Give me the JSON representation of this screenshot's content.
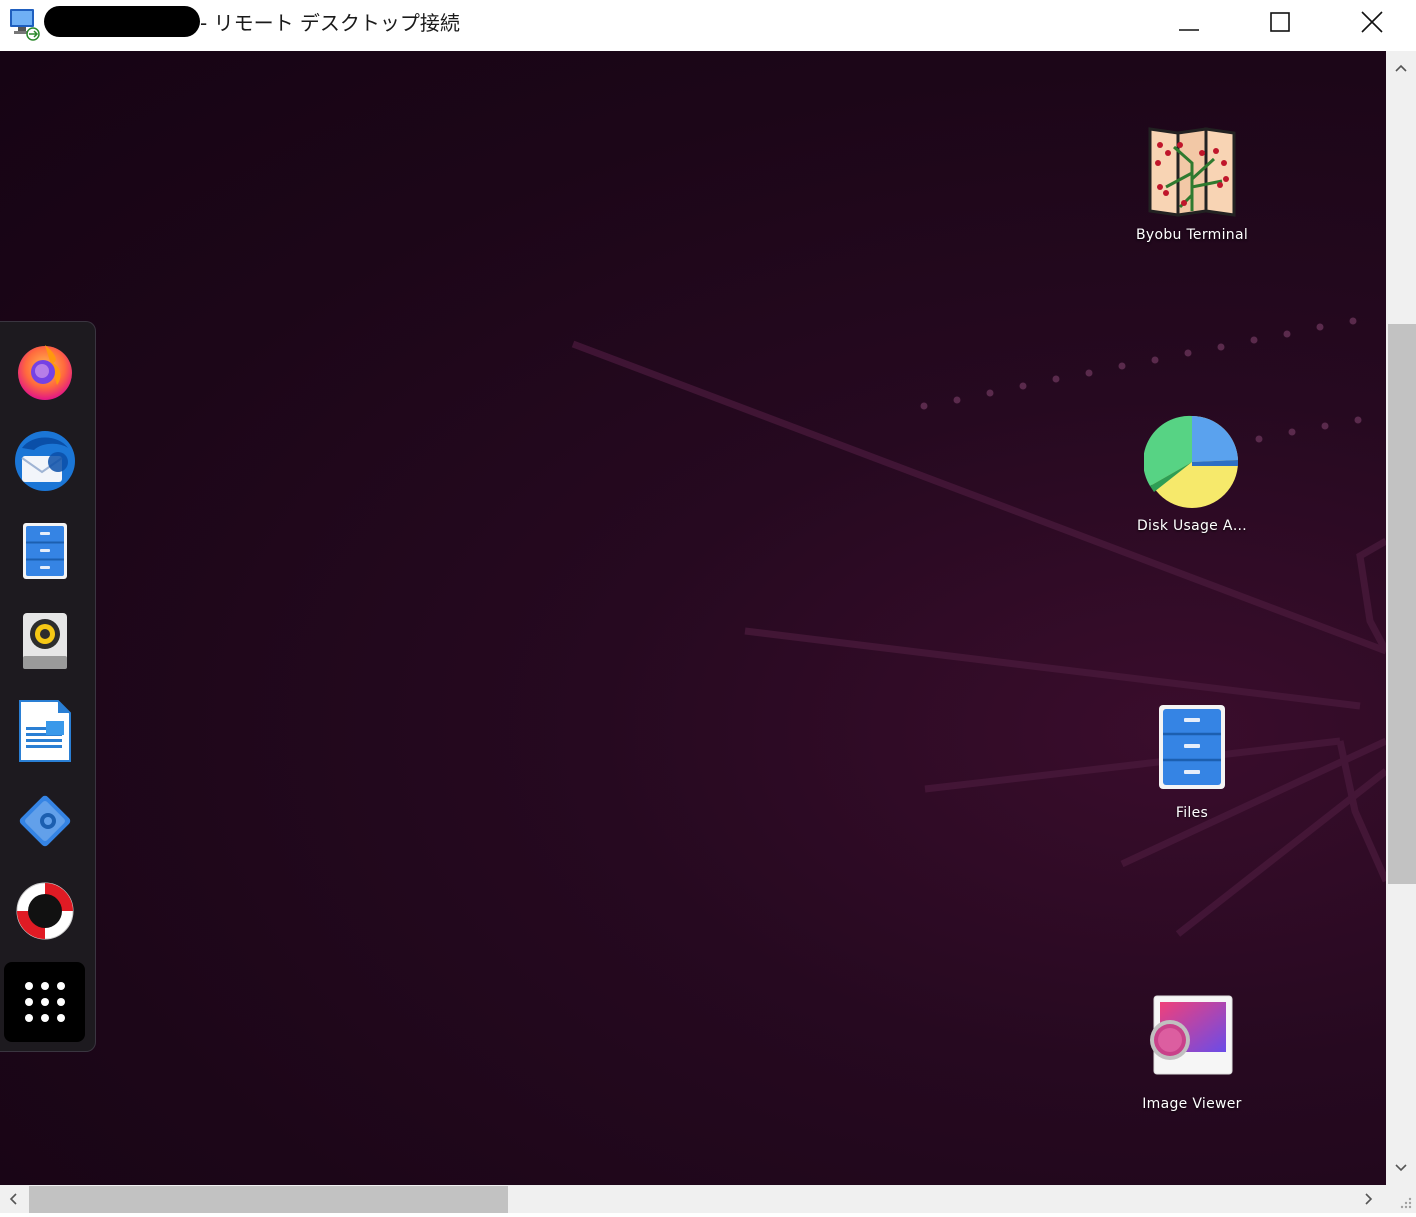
{
  "window": {
    "title_suffix": "- リモート デスクトップ接続",
    "app_icon": "remote-desktop-icon",
    "controls": {
      "minimize": "minimize-icon",
      "maximize": "maximize-icon",
      "close": "close-icon"
    }
  },
  "dock": {
    "items": [
      {
        "name": "Firefox",
        "icon": "firefox-icon"
      },
      {
        "name": "Thunderbird",
        "icon": "thunderbird-icon"
      },
      {
        "name": "Files",
        "icon": "files-icon"
      },
      {
        "name": "Rhythmbox",
        "icon": "rhythmbox-icon"
      },
      {
        "name": "LibreOffice Writer",
        "icon": "libreoffice-writer-icon"
      },
      {
        "name": "Ubuntu Software",
        "icon": "software-icon"
      },
      {
        "name": "Help",
        "icon": "help-icon"
      }
    ],
    "show_apps": "show-apps-grid-icon"
  },
  "desktop_icons": [
    {
      "label": "Byobu Terminal",
      "icon": "byobu-terminal-icon"
    },
    {
      "label": "Disk Usage A…",
      "icon": "disk-usage-icon"
    },
    {
      "label": "Files",
      "icon": "files-icon"
    },
    {
      "label": "Image Viewer",
      "icon": "image-viewer-icon"
    }
  ],
  "colors": {
    "wallpaper": "#1c0618",
    "dock_bg": "#1d1a1f",
    "accent": "#e95420"
  }
}
